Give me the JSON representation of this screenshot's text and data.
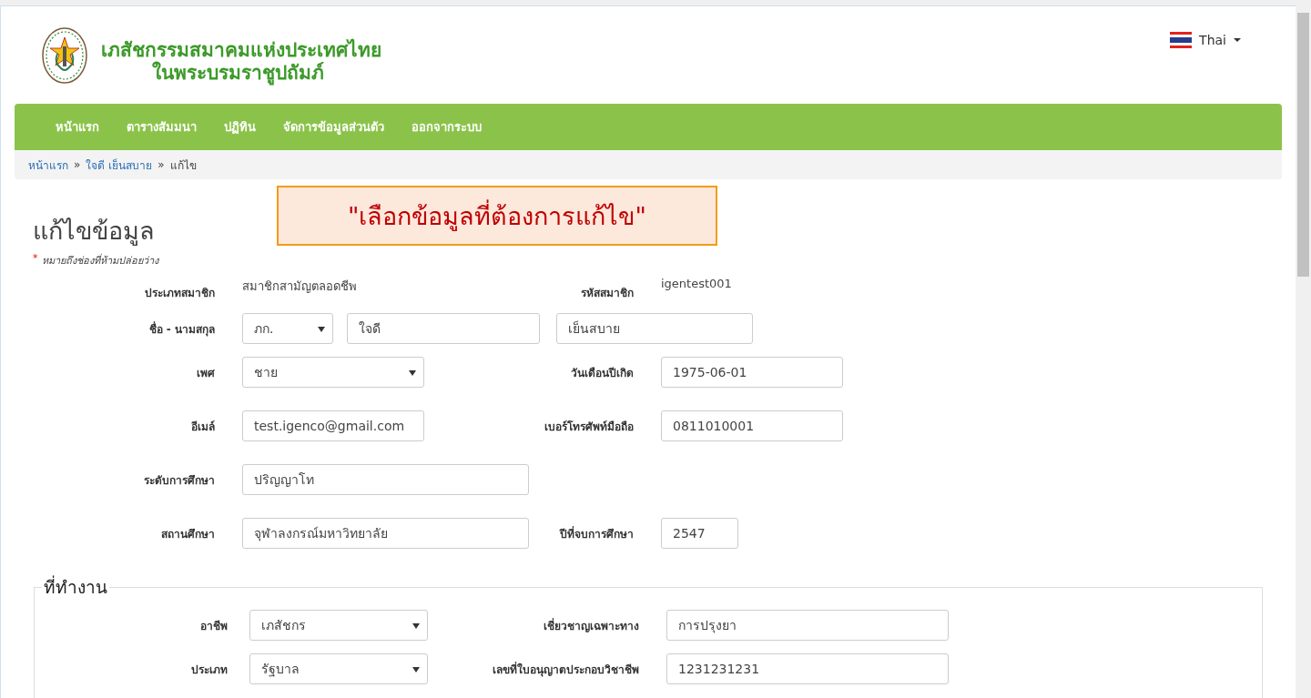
{
  "header": {
    "title_lines": [
      "เภสัชกรรมสมาคมแห่งประเทศไทย",
      "ในพระบรมราชูปถัมภ์"
    ],
    "language": "Thai"
  },
  "nav": {
    "items": [
      "หน้าแรก",
      "ตารางสัมมนา",
      "ปฏิทิน",
      "จัดการข้อมูลส่วนตัว",
      "ออกจากระบบ"
    ]
  },
  "breadcrumb_separator": "»",
  "breadcrumb": [
    {
      "label": "หน้าแรก",
      "current": false
    },
    {
      "label": "ใจดี เย็นสบาย",
      "current": false
    },
    {
      "label": "แก้ไข",
      "current": true
    }
  ],
  "callout": "\"เลือกข้อมูลที่ต้องการแก้ไข\"",
  "page_title": "แก้ไขข้อมูล",
  "required_note": {
    "mark": "*",
    "text": "หมายถึงช่องที่ห้ามปล่อยว่าง"
  },
  "rows": [
    {
      "cells": [
        {
          "label": "ประเภทสมาชิก",
          "kind": "static",
          "value": "สมาชิกสามัญตลอดชีพ"
        },
        {
          "label": "รหัสสมาชิก",
          "kind": "static",
          "value": "igentest001"
        }
      ]
    },
    {
      "cells": [
        {
          "label": "ชื่อ - นามสกุล",
          "kind": "name",
          "parts": [
            {
              "kind": "select",
              "value": "ภก."
            },
            {
              "kind": "input",
              "value": "ใจดี"
            },
            {
              "kind": "input",
              "value": "เย็นสบาย"
            }
          ]
        }
      ]
    },
    {
      "cells": [
        {
          "label": "เพศ",
          "kind": "select",
          "value": "ชาย"
        },
        {
          "label": "วันเดือนปีเกิด",
          "kind": "input",
          "value": "1975-06-01"
        }
      ]
    },
    {
      "cells": [
        {
          "label": "อีเมล์",
          "kind": "input",
          "value": "test.igenco@gmail.com"
        },
        {
          "label": "เบอร์โทรศัพท์มือถือ",
          "kind": "input",
          "value": "0811010001"
        }
      ]
    },
    {
      "cells": [
        {
          "label": "ระดับการศึกษา",
          "kind": "input",
          "value": "ปริญญาโท"
        }
      ]
    },
    {
      "cells": [
        {
          "label": "สถานศึกษา",
          "kind": "input",
          "value": "จุฬาลงกรณ์มหาวิทยาลัย"
        },
        {
          "label": "ปีที่จบการศึกษา",
          "kind": "input",
          "value": "2547"
        }
      ]
    }
  ],
  "workplace": {
    "legend": "ที่ทำงาน",
    "rows": [
      {
        "cells": [
          {
            "label": "อาชีพ",
            "kind": "select",
            "value": "เภสัชกร"
          },
          {
            "label": "เชี่ยวชาญเฉพาะทาง",
            "kind": "input",
            "value": "การปรุงยา"
          }
        ]
      },
      {
        "cells": [
          {
            "label": "ประเภท",
            "kind": "select",
            "value": "รัฐบาล"
          },
          {
            "label": "เลขที่ใบอนุญาตประกอบวิชาชีพ",
            "kind": "input",
            "value": "1231231231"
          }
        ]
      }
    ]
  }
}
